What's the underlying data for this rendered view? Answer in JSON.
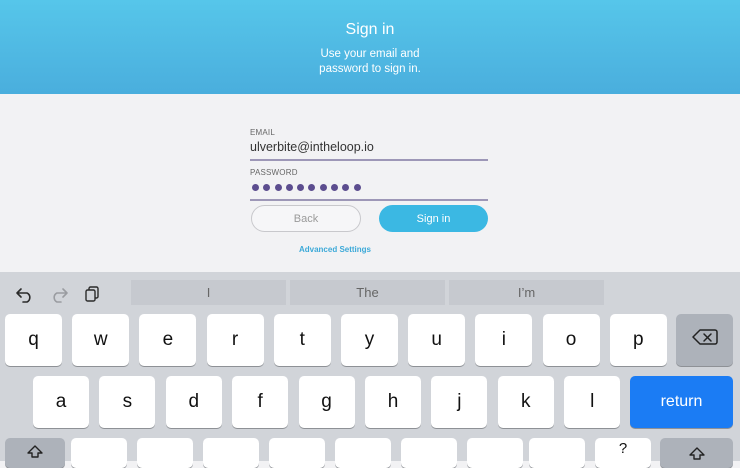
{
  "header": {
    "title": "Sign in",
    "subtitle_line1": "Use your email and",
    "subtitle_line2": "password to sign in."
  },
  "form": {
    "email_label": "EMAIL",
    "email_value": "ulverbite@intheloop.io",
    "password_label": "PASSWORD",
    "password_dot_count": 10,
    "back_label": "Back",
    "signin_label": "Sign in",
    "advanced_label": "Advanced Settings"
  },
  "keyboard": {
    "suggestions": [
      "I",
      "The",
      "I’m"
    ],
    "row1": [
      "q",
      "w",
      "e",
      "r",
      "t",
      "y",
      "u",
      "i",
      "o",
      "p"
    ],
    "row2": [
      "a",
      "s",
      "d",
      "f",
      "g",
      "h",
      "j",
      "k",
      "l"
    ],
    "row3_visible": [
      "?",
      "⇧"
    ],
    "return_label": "return",
    "tools": [
      "undo-icon",
      "redo-icon",
      "paste-icon"
    ],
    "shift_icon": "shift-icon",
    "backspace_icon": "backspace-icon"
  },
  "colors": {
    "header_top": "#56c6ea",
    "header_bottom": "#4aaedd",
    "accent": "#3bb8e3",
    "password_dots": "#5c4d8f",
    "return_key": "#1b7cf4"
  }
}
